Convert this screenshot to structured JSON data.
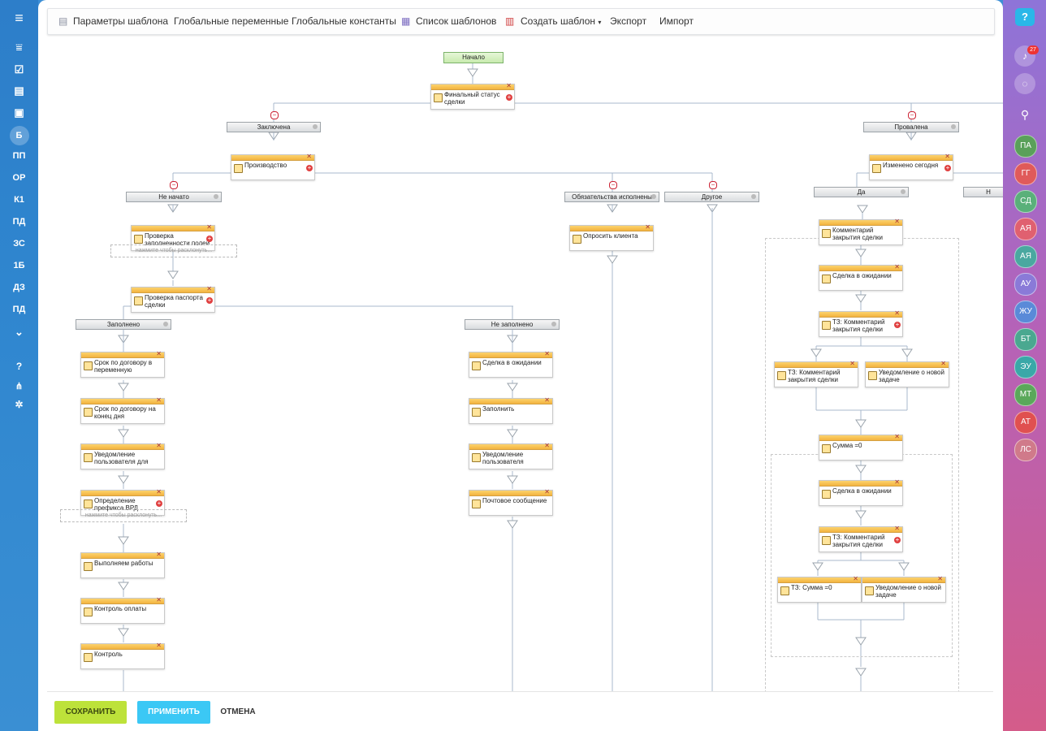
{
  "toolbar": {
    "template_params": "Параметры шаблона",
    "global_vars": "Глобальные переменные",
    "global_consts": "Глобальные константы",
    "template_list": "Список шаблонов",
    "create_template": "Создать шаблон",
    "export": "Экспорт",
    "import": "Импорт"
  },
  "left_sidebar": [
    "Б",
    "ПП",
    "ОР",
    "К1",
    "ПД",
    "ЗС",
    "1Б",
    "ДЗ",
    "ПД"
  ],
  "right_sidebar": {
    "notifications_count": "27",
    "avatars": [
      {
        "text": "ПА",
        "color": "#5aa05a"
      },
      {
        "text": "ГГ",
        "color": "#e05a5a"
      },
      {
        "text": "СД",
        "color": "#5ab07a"
      },
      {
        "text": "АЯ",
        "color": "#e06070"
      },
      {
        "text": "АЯ",
        "color": "#4aa8a0"
      },
      {
        "text": "АУ",
        "color": "#8a7ad8"
      },
      {
        "text": "ЖУ",
        "color": "#5a8ad8"
      },
      {
        "text": "БТ",
        "color": "#4aa890"
      },
      {
        "text": "ЭУ",
        "color": "#3aa8a8"
      },
      {
        "text": "МТ",
        "color": "#5aa85a"
      },
      {
        "text": "АТ",
        "color": "#e05050"
      },
      {
        "text": "ЛС",
        "color": "#d07a8a"
      }
    ]
  },
  "workflow": {
    "start": "Начало",
    "expand_hint": "нажмите чтобы расклонуть...",
    "blocks": {
      "final_status": "Финальный статус сделки",
      "production": "Производство",
      "changed_today": "Изменено сегодня",
      "check_fields": "Проверка заполненности полей",
      "check_passport": "Проверка паспорта сделки",
      "ask_client": "Опросить клиента",
      "close_comment": "Комментарий закрытия сделки",
      "deal_waiting_1": "Сделка в ожидании",
      "tz_close_comment_1": "ТЗ: Комментарий закрытия сделки",
      "tz_close_comment_2": "ТЗ: Комментарий закрытия сделки",
      "notify_new_task_1": "Уведомление о новой задаче",
      "sum_zero": "Сумма =0",
      "deal_waiting_2": "Сделка в ожидании",
      "tz_close_comment_3": "ТЗ: Комментарий закрытия сделки",
      "tz_sum_zero": "ТЗ: Сумма =0",
      "notify_new_task_2": "Уведомление о новой задаче",
      "contract_term_var": "Срок по договору в переменную",
      "contract_term_eod": "Срок по договору на конец дня",
      "notify_user_for": "Уведомление пользователя для",
      "define_prefix": "Определение префикса ВРД",
      "doing_work": "Выполняем работы",
      "payment_control": "Контроль оплаты",
      "control": "Контроль",
      "deal_waiting_3": "Сделка в ожидании",
      "fill_in": "Заполнить",
      "notify_users": "Уведомление пользователя",
      "mail_message": "Почтовое сообщение"
    },
    "branches": {
      "concluded": "Заключена",
      "failed": "Провалена",
      "not_started": "Не начато",
      "obligations_done": "Обязательства исполнены",
      "other": "Другое",
      "yes": "Да",
      "filled": "Заполнено",
      "not_filled": "Не заполнено",
      "cut": "Н"
    }
  },
  "footer": {
    "save": "СОХРАНИТЬ",
    "apply": "ПРИМЕНИТЬ",
    "cancel": "ОТМЕНА"
  }
}
